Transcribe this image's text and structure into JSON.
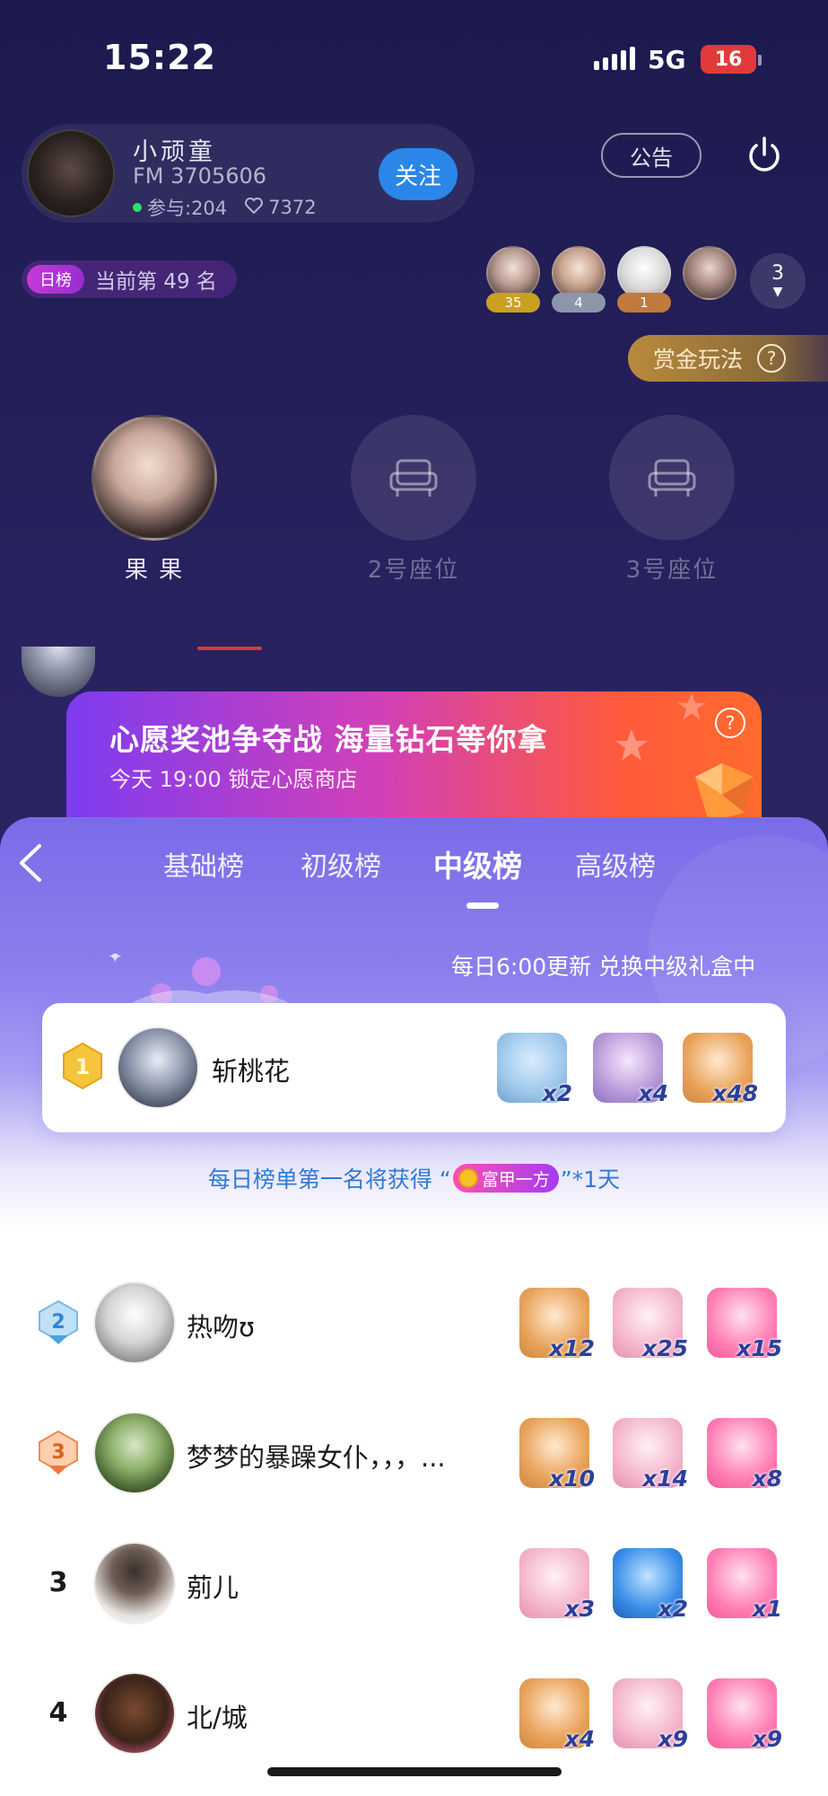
{
  "status": {
    "time": "15:22",
    "network": "5G",
    "battery": "16"
  },
  "host": {
    "name": "小顽童",
    "fm": "FM 3705606",
    "participants": "参与:204",
    "likes": "7372",
    "follow_label": "关注"
  },
  "header": {
    "notice_label": "公告"
  },
  "rank": {
    "tag": "日榜",
    "text": "当前第 49 名"
  },
  "top_contributors": [
    {
      "badge": "35",
      "badge_color": "#c9a020"
    },
    {
      "badge": "4",
      "badge_color": "#9aa3b3"
    },
    {
      "badge": "1",
      "badge_color": "#c98a4a"
    },
    {
      "badge": "",
      "badge_color": ""
    }
  ],
  "top_more": "3",
  "bounty": {
    "label": "赏金玩法",
    "help": "?"
  },
  "seats": [
    {
      "label": "果 果",
      "occupied": true
    },
    {
      "label": "2号座位",
      "occupied": false
    },
    {
      "label": "3号座位",
      "occupied": false
    }
  ],
  "banner": {
    "title": "心愿奖池争夺战 海量钻石等你拿",
    "subtitle": "今天 19:00 锁定心愿商店",
    "help": "?"
  },
  "tabs": [
    {
      "label": "基础榜",
      "active": false
    },
    {
      "label": "初级榜",
      "active": false
    },
    {
      "label": "中级榜",
      "active": true
    },
    {
      "label": "高级榜",
      "active": false
    }
  ],
  "update_text": "每日6:00更新 兑换中级礼盒中",
  "first_place": {
    "rank": "1",
    "name": "斩桃花",
    "gifts": [
      {
        "icon": "couple-photo-gift",
        "count": "x2"
      },
      {
        "icon": "wedding-couple-gift",
        "count": "x4"
      },
      {
        "icon": "bear-envelope-gift",
        "count": "x48"
      }
    ]
  },
  "reward": {
    "prefix": "每日榜单第一名将获得 “",
    "badge": "富甲一方",
    "suffix": "”*1天"
  },
  "leaderboard": [
    {
      "rank": "2",
      "medal": true,
      "name": "热吻ʊ",
      "gifts": [
        {
          "icon": "bear-envelope-gift",
          "count": "x12"
        },
        {
          "icon": "pink-bear-gift",
          "count": "x25"
        },
        {
          "icon": "heart-balloon-gift",
          "count": "x15"
        }
      ]
    },
    {
      "rank": "3",
      "medal": true,
      "name": "梦梦的暴躁女仆，，，...",
      "gifts": [
        {
          "icon": "bear-envelope-gift",
          "count": "x10"
        },
        {
          "icon": "pink-bear-gift",
          "count": "x14"
        },
        {
          "icon": "heart-balloon-gift",
          "count": "x8"
        }
      ]
    },
    {
      "rank": "3",
      "medal": false,
      "name": "莂儿",
      "gifts": [
        {
          "icon": "pink-bear-gift",
          "count": "x3"
        },
        {
          "icon": "magic-book-gift",
          "count": "x2"
        },
        {
          "icon": "heart-balloon-gift",
          "count": "x1"
        }
      ]
    },
    {
      "rank": "4",
      "medal": false,
      "name": "北/城",
      "gifts": [
        {
          "icon": "bear-envelope-gift",
          "count": "x4"
        },
        {
          "icon": "pink-bear-gift",
          "count": "x9"
        },
        {
          "icon": "heart-balloon-gift",
          "count": "x9"
        }
      ]
    }
  ],
  "colors": {
    "gift_bear_envelope": "#e8a25a",
    "gift_pink_bear": "#f4b6cc",
    "gift_heart_balloon": "#ff7fb5",
    "gift_magic_book": "#3a8ee8",
    "gift_couple_photo": "#9cc7ea",
    "gift_wedding": "#b79ad8"
  }
}
